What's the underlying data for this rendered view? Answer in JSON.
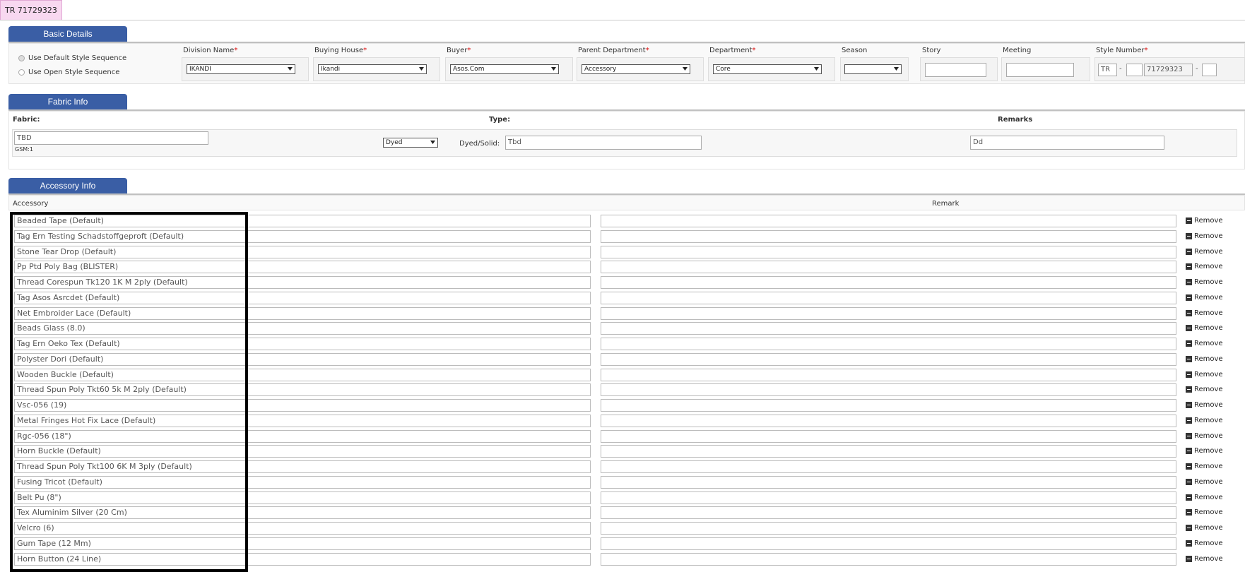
{
  "header": {
    "record_tab": "TR 71729323"
  },
  "basic_details": {
    "title": "Basic Details",
    "sequence_options": [
      {
        "label": "Use Default Style Sequence",
        "checked": true
      },
      {
        "label": "Use Open Style Sequence",
        "checked": false
      }
    ],
    "fields": {
      "division": {
        "label": "Division Name",
        "required": "*",
        "value": "IKANDI"
      },
      "buying_house": {
        "label": "Buying House",
        "required": "*",
        "value": "Ikandi"
      },
      "buyer": {
        "label": "Buyer",
        "required": "*",
        "value": "Asos.Com"
      },
      "parent_department": {
        "label": "Parent Department",
        "required": "*",
        "value": "Accessory"
      },
      "department": {
        "label": "Department",
        "required": "*",
        "value": "Core"
      },
      "season": {
        "label": "Season",
        "value": ""
      },
      "story": {
        "label": "Story",
        "value": ""
      },
      "meeting": {
        "label": "Meeting",
        "value": ""
      },
      "style_number": {
        "label": "Style Number",
        "required": "*",
        "prefix": "TR",
        "middle": "",
        "number": "71729323",
        "suffix": "",
        "separator": "-"
      }
    }
  },
  "fabric_info": {
    "title": "Fabric Info",
    "fabric_label": "Fabric:",
    "fabric_value": "TBD",
    "gsm": "GSM:1",
    "type_label": "Type:",
    "type_select": "Dyed",
    "dyed_solid_label": "Dyed/Solid:",
    "dyed_solid_value": "Tbd",
    "remarks_label": "Remarks",
    "remarks_value": "Dd"
  },
  "accessory_info": {
    "title": "Accessory Info",
    "col_accessory": "Accessory",
    "col_remark": "Remark",
    "remove_label": "Remove",
    "items": [
      "Beaded Tape (Default)",
      "Tag Ern Testing Schadstoffgeproft (Default)",
      "Stone Tear Drop (Default)",
      "Pp Ptd Poly Bag (BLISTER)",
      "Thread Corespun Tk120 1K M 2ply (Default)",
      "Tag Asos Asrcdet (Default)",
      "Net Embroider Lace (Default)",
      "Beads Glass (8.0)",
      "Tag Ern Oeko Tex (Default)",
      "Polyster Dori (Default)",
      "Wooden Buckle (Default)",
      "Thread Spun Poly Tkt60 5k M 2ply (Default)",
      "Vsc-056 (19)",
      "Metal Fringes Hot Fix Lace (Default)",
      "Rgc-056 (18\")",
      "Horn Buckle (Default)",
      "Thread Spun Poly Tkt100 6K M 3ply (Default)",
      "Fusing Tricot (Default)",
      "Belt Pu (8\")",
      "Tex Aluminim Silver (20 Cm)",
      "Velcro (6)",
      "Gum Tape (12 Mm)",
      "Horn Button (24 Line)"
    ]
  }
}
